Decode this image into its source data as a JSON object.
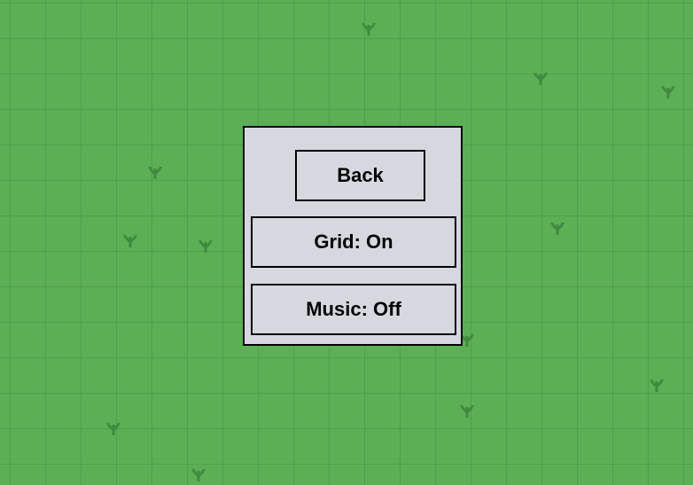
{
  "settings_menu": {
    "back_label": "Back",
    "grid_label": "Grid: On",
    "music_label": "Music: Off"
  },
  "colors": {
    "grass": "#5daf55",
    "grass_lines": "#4d9a48",
    "tuft": "#3f8a3f",
    "panel": "#d6d8df",
    "border": "#000000"
  },
  "decor": {
    "icon": "grass-tuft-icon"
  }
}
